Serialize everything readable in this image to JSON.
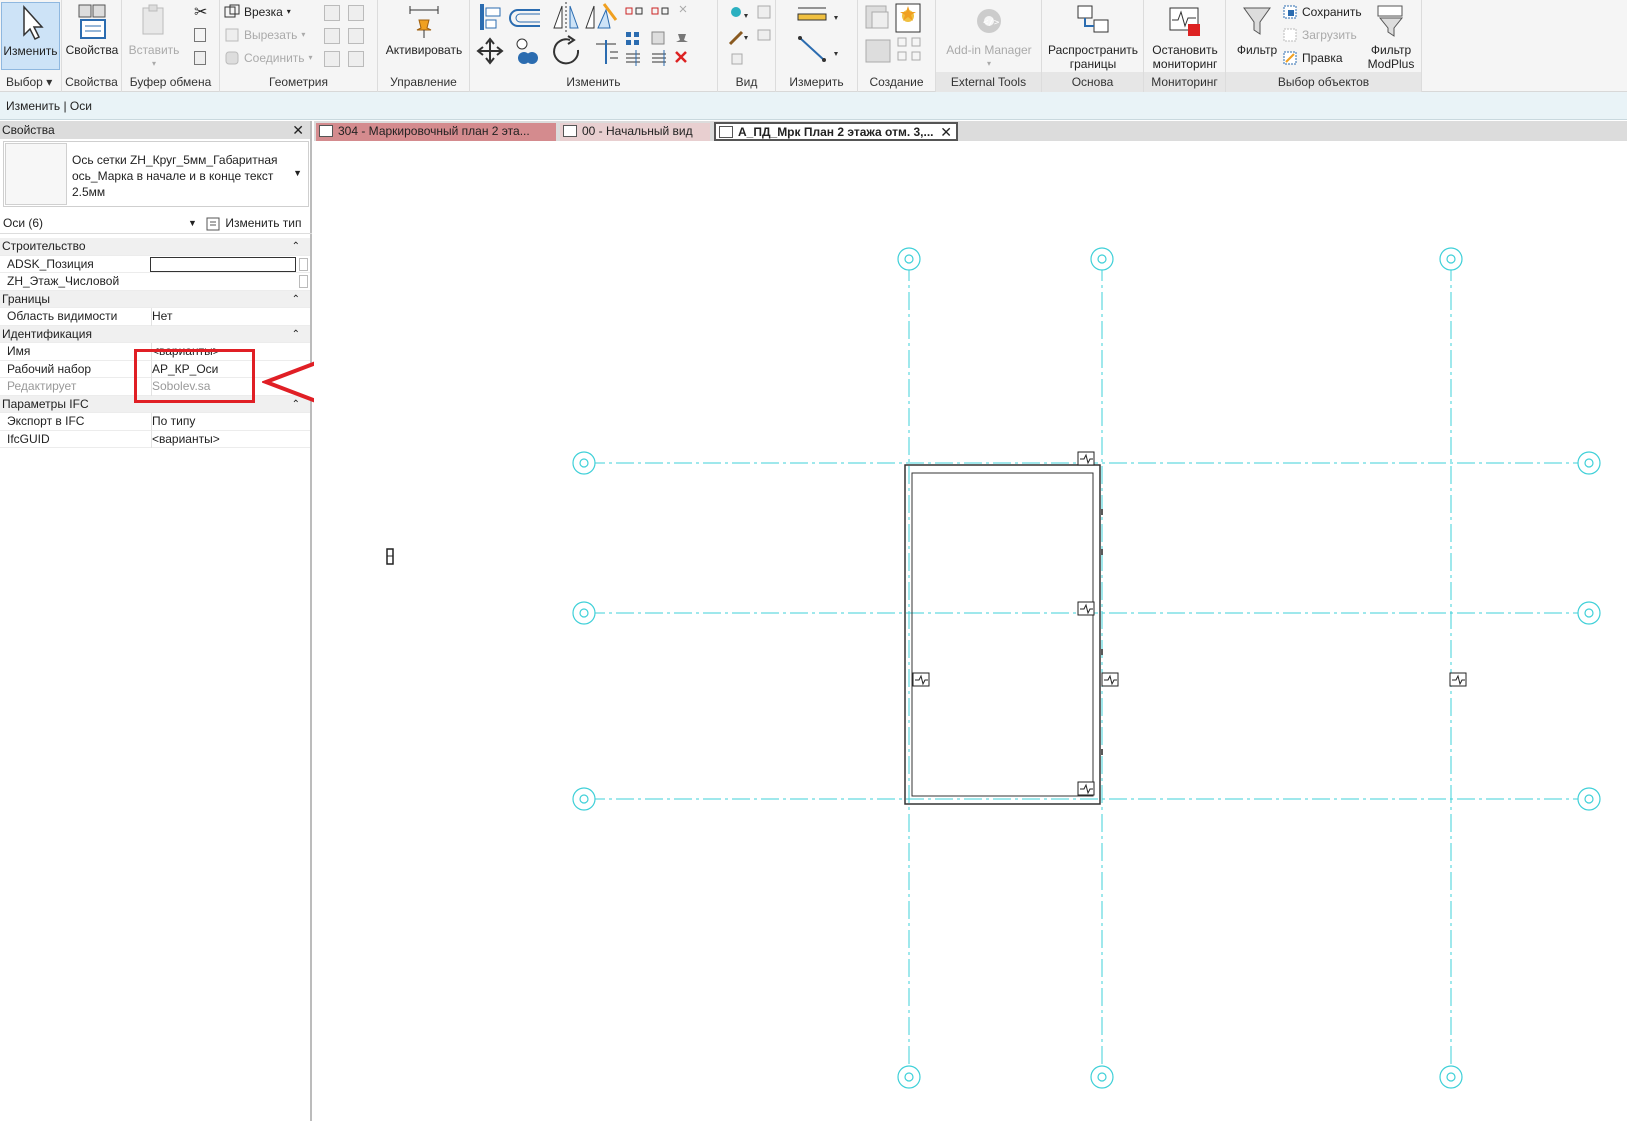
{
  "ribbon": {
    "modify": "Изменить",
    "properties": "Свойства",
    "paste": "Вставить",
    "cut_geom": "Врезка",
    "cut": "Вырезать",
    "join": "Соединить",
    "activate": "Активировать",
    "addin_manager": "Add-in Manager",
    "distribute_bounds_1": "Распространить",
    "distribute_bounds_2": "границы",
    "stop_monitor_1": "Остановить",
    "stop_monitor_2": "мониторинг",
    "filter": "Фильтр",
    "save_sel": "Сохранить",
    "load_sel": "Загрузить",
    "edit_sel": "Правка",
    "modplus_1": "Фильтр",
    "modplus_2": "ModPlus",
    "panels": {
      "select": "Выбор",
      "properties": "Свойства",
      "clipboard": "Буфер обмена",
      "geometry": "Геометрия",
      "control": "Управление",
      "modify": "Изменить",
      "view": "Вид",
      "measure": "Измерить",
      "create": "Создание",
      "external": "External Tools",
      "basis": "Основа",
      "monitoring": "Мониторинг",
      "selection": "Выбор объектов"
    }
  },
  "options_bar": "Изменить | Оси",
  "properties_panel": {
    "title": "Свойства",
    "type_name": "Ось сетки ZH_Круг_5мм_Габаритная ось_Марка в начале и в конце текст 2.5мм",
    "instance_filter": "Оси (6)",
    "edit_type": "Изменить тип",
    "groups": [
      {
        "name": "Строительство",
        "rows": [
          {
            "key": "ADSK_Позиция",
            "value": ""
          },
          {
            "key": "ZH_Этаж_Числовой",
            "value": ""
          }
        ]
      },
      {
        "name": "Границы",
        "rows": [
          {
            "key": "Область видимости",
            "value": "Нет"
          }
        ]
      },
      {
        "name": "Идентификация",
        "rows": [
          {
            "key": "Имя",
            "value": "<варианты>"
          },
          {
            "key": "Рабочий набор",
            "value": "АР_КР_Оси"
          },
          {
            "key": "Редактирует",
            "value": "Sobolev.sa"
          }
        ]
      },
      {
        "name": "Параметры IFC",
        "rows": [
          {
            "key": "Экспорт в IFC",
            "value": "По типу"
          },
          {
            "key": "IfcGUID",
            "value": "<варианты>"
          }
        ]
      }
    ]
  },
  "tabs": [
    {
      "label": "304 - Маркировочный план 2 эта..."
    },
    {
      "label": "00 - Начальный вид"
    },
    {
      "label": "А_ПД_Мрк План 2 этажа отм. 3,..."
    }
  ],
  "colors": {
    "grid_line": "#3fd0d8",
    "callout": "#e01f25",
    "selection_blue": "#cde3f7"
  }
}
